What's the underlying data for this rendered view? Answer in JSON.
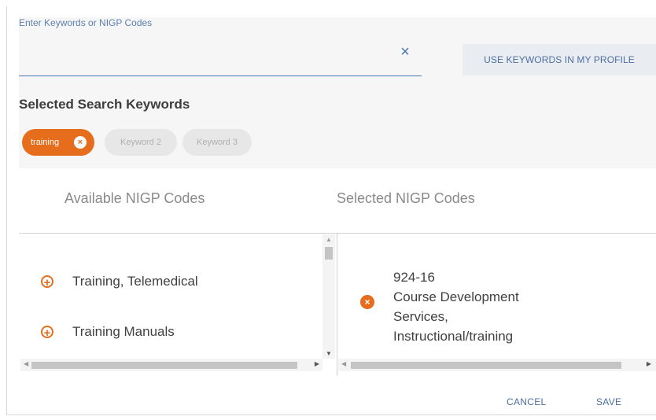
{
  "search": {
    "label": "Enter Keywords or NIGP Codes",
    "value": "",
    "clear_glyph": "×",
    "profile_button": "USE KEYWORDS IN MY PROFILE"
  },
  "selected_keywords": {
    "heading": "Selected Search Keywords",
    "chips": [
      {
        "label": "training",
        "remove_glyph": "×"
      },
      {
        "label": "Keyword 2"
      },
      {
        "label": "Keyword 3"
      }
    ]
  },
  "codes": {
    "available_header": "Available NIGP Codes",
    "selected_header": "Selected NIGP Codes",
    "available_items": [
      {
        "label": "Training, Telemedical",
        "icon": "add-circle-icon"
      },
      {
        "label": "Training Manuals",
        "icon": "add-circle-icon"
      }
    ],
    "selected_items": [
      {
        "code": "924-16",
        "lines": [
          "Course Development",
          "Services,",
          "Instructional/training"
        ],
        "icon": "remove-circle-icon"
      }
    ]
  },
  "footer": {
    "cancel": "CANCEL",
    "save": "SAVE"
  },
  "colors": {
    "accent": "#e56d1b",
    "link": "#4d6fa1",
    "panel": "#f6f6f6"
  }
}
